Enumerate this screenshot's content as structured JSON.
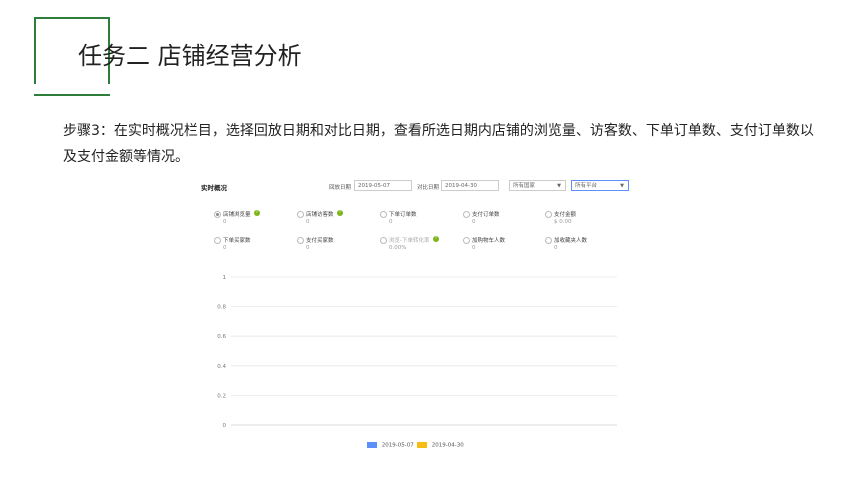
{
  "slide": {
    "title": "任务二 店铺经营分析",
    "step_text": "步骤3：在实时概况栏目，选择回放日期和对比日期，查看所选日期内店铺的浏览量、访客数、下单订单数、支付订单数以及支付金额等情况。"
  },
  "panel": {
    "title": "实时概况",
    "replay_label": "回放日期",
    "replay_date": "2019-05-07",
    "compare_label": "对比日期",
    "compare_date": "2019-04-30",
    "region_select": "所有国家",
    "platform_select": "所有平台"
  },
  "metrics": [
    {
      "name": "店铺浏览量",
      "value": "0",
      "selected": true,
      "help": true
    },
    {
      "name": "店铺访客数",
      "value": "0",
      "selected": false,
      "help": true
    },
    {
      "name": "下单订单数",
      "value": "0",
      "selected": false,
      "help": false
    },
    {
      "name": "支付订单数",
      "value": "0",
      "selected": false,
      "help": false
    },
    {
      "name": "支付金额",
      "value": "$ 0.00",
      "selected": false,
      "help": false
    },
    {
      "name": "下单买家数",
      "value": "0",
      "selected": false,
      "help": false
    },
    {
      "name": "支付买家数",
      "value": "0",
      "selected": false,
      "help": false
    },
    {
      "name": "浏览-下单转化率",
      "value": "0.00%",
      "selected": false,
      "help": true,
      "disabled": true
    },
    {
      "name": "加购物车人数",
      "value": "0",
      "selected": false,
      "help": false
    },
    {
      "name": "加收藏夹人数",
      "value": "0",
      "selected": false,
      "help": false
    }
  ],
  "chart_data": {
    "type": "line",
    "x": [],
    "series": [
      {
        "name": "2019-05-07",
        "values": [],
        "color": "#5b8ff9"
      },
      {
        "name": "2019-04-30",
        "values": [],
        "color": "#f6bd16"
      }
    ],
    "yticks": [
      "0",
      "0.2",
      "0.4",
      "0.6",
      "0.8",
      "1"
    ],
    "ylim": [
      0,
      1
    ],
    "grid": true,
    "legend": "bottom"
  },
  "colors": {
    "accent_green": "#2e7d3a",
    "help_green": "#7cb518"
  }
}
